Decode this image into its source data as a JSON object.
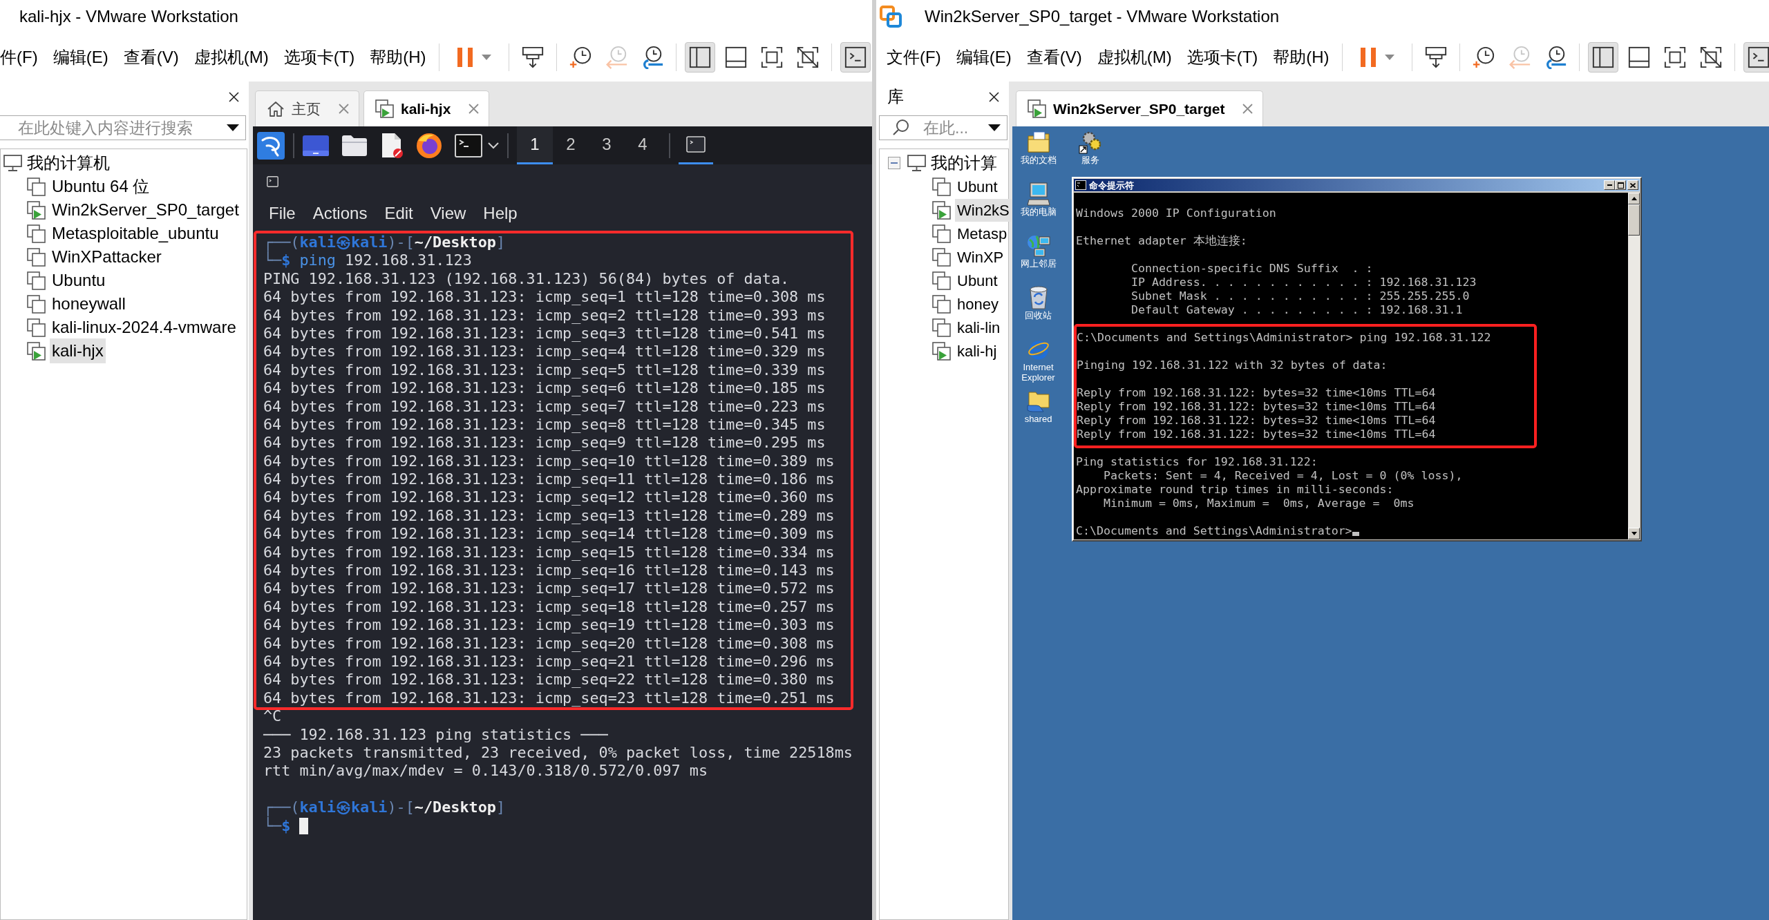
{
  "windows": [
    {
      "title": "kali-hjx - VMware Workstation",
      "menu": [
        "件(F)",
        "编辑(E)",
        "查看(V)",
        "虚拟机(M)",
        "选项卡(T)",
        "帮助(H)"
      ],
      "toolbar": [
        [
          {
            "kind": "pause",
            "dropdown": true
          }
        ],
        [
          {
            "kind": "send_keys"
          }
        ],
        [
          {
            "kind": "snapshot",
            "disabled": false
          },
          {
            "kind": "revert_snapshot",
            "disabled": true
          },
          {
            "kind": "snapshot_manager",
            "disabled": false
          }
        ],
        [
          {
            "kind": "library_view",
            "pressed": true
          },
          {
            "kind": "thumbnail_bar",
            "pressed": false
          },
          {
            "kind": "full_screen",
            "pressed": false
          },
          {
            "kind": "unity",
            "pressed": false
          }
        ],
        [
          {
            "kind": "console_view",
            "pressed": true
          }
        ]
      ],
      "sidebar": {
        "search": {
          "placeholder": "在此处键入内容进行搜索"
        },
        "tree": {
          "label": "我的计算机",
          "children": [
            {
              "label": "Ubuntu 64 位",
              "running": false,
              "selected": false
            },
            {
              "label": "Win2kServer_SP0_target",
              "running": true,
              "selected": false
            },
            {
              "label": "Metasploitable_ubuntu",
              "running": false,
              "selected": false
            },
            {
              "label": "WinXPattacker",
              "running": false,
              "selected": false
            },
            {
              "label": "Ubuntu",
              "running": false,
              "selected": false
            },
            {
              "label": "honeywall",
              "running": false,
              "selected": false
            },
            {
              "label": "kali-linux-2024.4-vmware",
              "running": false,
              "selected": false
            },
            {
              "label": "kali-hjx",
              "running": true,
              "selected": true
            }
          ]
        }
      },
      "tabs": [
        {
          "kind": "home",
          "label": "主页",
          "selected": false
        },
        {
          "kind": "vm",
          "label": "kali-hjx",
          "selected": true
        }
      ],
      "guest": {
        "kind": "kali",
        "panel": {
          "launchers": [
            {
              "kind": "app_menu"
            },
            {
              "kind": "desktop"
            },
            {
              "kind": "files"
            },
            {
              "kind": "text_editor"
            },
            {
              "kind": "web_browser"
            },
            {
              "kind": "terminal",
              "dropdown": true
            }
          ],
          "workspaces": [
            {
              "label": "1",
              "selected": true
            },
            {
              "label": "2",
              "selected": false
            },
            {
              "label": "3",
              "selected": false
            },
            {
              "label": "4",
              "selected": false
            }
          ],
          "tasks": [
            {
              "kind": "terminal",
              "focused": true
            }
          ]
        },
        "terminal": {
          "menu": [
            "File",
            "Actions",
            "Edit",
            "View",
            "Help"
          ],
          "sections": [
            {
              "highlighted": true,
              "paragraphs": [
                [
                  {
                    "parts": [
                      {
                        "kind": "frame",
                        "text": "┌──("
                      },
                      {
                        "kind": "user",
                        "text": "kali㉿kali"
                      },
                      {
                        "kind": "frame",
                        "text": ")-["
                      },
                      {
                        "kind": "path",
                        "text": "~/Desktop"
                      },
                      {
                        "kind": "frame",
                        "text": "]"
                      }
                    ]
                  },
                  {
                    "parts": [
                      {
                        "kind": "frame",
                        "text": "└─"
                      },
                      {
                        "kind": "prompt",
                        "text": "$"
                      },
                      {
                        "kind": "command",
                        "text": "ping"
                      },
                      {
                        "kind": "argument",
                        "text": "192.168.31.123"
                      }
                    ]
                  },
                  "PING 192.168.31.123 (192.168.31.123) 56(84) bytes of data.",
                  "64 bytes from 192.168.31.123: icmp_seq=1 ttl=128 time=0.308 ms",
                  "64 bytes from 192.168.31.123: icmp_seq=2 ttl=128 time=0.393 ms",
                  "64 bytes from 192.168.31.123: icmp_seq=3 ttl=128 time=0.541 ms",
                  "64 bytes from 192.168.31.123: icmp_seq=4 ttl=128 time=0.329 ms",
                  "64 bytes from 192.168.31.123: icmp_seq=5 ttl=128 time=0.339 ms",
                  "64 bytes from 192.168.31.123: icmp_seq=6 ttl=128 time=0.185 ms",
                  "64 bytes from 192.168.31.123: icmp_seq=7 ttl=128 time=0.223 ms",
                  "64 bytes from 192.168.31.123: icmp_seq=8 ttl=128 time=0.345 ms",
                  "64 bytes from 192.168.31.123: icmp_seq=9 ttl=128 time=0.295 ms",
                  "64 bytes from 192.168.31.123: icmp_seq=10 ttl=128 time=0.389 ms",
                  "64 bytes from 192.168.31.123: icmp_seq=11 ttl=128 time=0.186 ms",
                  "64 bytes from 192.168.31.123: icmp_seq=12 ttl=128 time=0.360 ms",
                  "64 bytes from 192.168.31.123: icmp_seq=13 ttl=128 time=0.289 ms",
                  "64 bytes from 192.168.31.123: icmp_seq=14 ttl=128 time=0.309 ms",
                  "64 bytes from 192.168.31.123: icmp_seq=15 ttl=128 time=0.334 ms",
                  "64 bytes from 192.168.31.123: icmp_seq=16 ttl=128 time=0.143 ms",
                  "64 bytes from 192.168.31.123: icmp_seq=17 ttl=128 time=0.572 ms",
                  "64 bytes from 192.168.31.123: icmp_seq=18 ttl=128 time=0.257 ms",
                  "64 bytes from 192.168.31.123: icmp_seq=19 ttl=128 time=0.303 ms",
                  "64 bytes from 192.168.31.123: icmp_seq=20 ttl=128 time=0.308 ms",
                  "64 bytes from 192.168.31.123: icmp_seq=21 ttl=128 time=0.296 ms",
                  "64 bytes from 192.168.31.123: icmp_seq=22 ttl=128 time=0.380 ms",
                  "64 bytes from 192.168.31.123: icmp_seq=23 ttl=128 time=0.251 ms"
                ]
              ]
            },
            {
              "highlighted": false,
              "paragraphs": [
                [
                  "^C",
                  "─── 192.168.31.123 ping statistics ───",
                  "23 packets transmitted, 23 received, 0% packet loss, time 22518ms",
                  "rtt min/avg/max/mdev = 0.143/0.318/0.572/0.097 ms"
                ],
                [
                  {
                    "parts": [
                      {
                        "kind": "frame",
                        "text": "┌──("
                      },
                      {
                        "kind": "user",
                        "text": "kali㉿kali"
                      },
                      {
                        "kind": "frame",
                        "text": ")-["
                      },
                      {
                        "kind": "path",
                        "text": "~/Desktop"
                      },
                      {
                        "kind": "frame",
                        "text": "]"
                      }
                    ]
                  },
                  {
                    "parts": [
                      {
                        "kind": "frame",
                        "text": "└─"
                      },
                      {
                        "kind": "prompt",
                        "text": "$"
                      }
                    ],
                    "cursor": true
                  }
                ]
              ]
            }
          ]
        }
      }
    },
    {
      "app_icon": true,
      "title": "Win2kServer_SP0_target - VMware Workstation",
      "menu": [
        "文件(F)",
        "编辑(E)",
        "查看(V)",
        "虚拟机(M)",
        "选项卡(T)",
        "帮助(H)"
      ],
      "toolbar": [
        [
          {
            "kind": "pause",
            "dropdown": true
          }
        ],
        [
          {
            "kind": "send_keys"
          }
        ],
        [
          {
            "kind": "snapshot",
            "disabled": false
          },
          {
            "kind": "revert_snapshot",
            "disabled": true
          },
          {
            "kind": "snapshot_manager",
            "disabled": false
          }
        ],
        [
          {
            "kind": "library_view",
            "pressed": true
          },
          {
            "kind": "thumbnail_bar",
            "pressed": false
          },
          {
            "kind": "full_screen",
            "pressed": false
          },
          {
            "kind": "unity",
            "pressed": false
          }
        ],
        [
          {
            "kind": "console_view",
            "pressed": true
          }
        ]
      ],
      "sidebar": {
        "title": "库",
        "search": {
          "placeholder": "在此..."
        },
        "tree": {
          "label": "我的计算",
          "expanded": true,
          "children": [
            {
              "label": "Ubunt",
              "running": false,
              "selected": false
            },
            {
              "label": "Win2kS",
              "running": true,
              "selected": true
            },
            {
              "label": "Metasp",
              "running": false,
              "selected": false
            },
            {
              "label": "WinXP",
              "running": false,
              "selected": false
            },
            {
              "label": "Ubunt",
              "running": false,
              "selected": false
            },
            {
              "label": "honey",
              "running": false,
              "selected": false
            },
            {
              "label": "kali-lin",
              "running": false,
              "selected": false
            },
            {
              "label": "kali-hj",
              "running": true,
              "selected": false
            }
          ]
        }
      },
      "tabs": [
        {
          "kind": "vm",
          "label": "Win2kServer_SP0_target",
          "selected": true
        }
      ],
      "guest": {
        "kind": "win2000",
        "desktop_icon_columns": [
          [
            {
              "kind": "documents",
              "label": "我的文档"
            },
            {
              "kind": "computer",
              "label": "我的电脑"
            },
            {
              "kind": "network",
              "label": "网上邻居"
            },
            {
              "kind": "recycle_bin",
              "label": "回收站"
            },
            {
              "kind": "browser",
              "label": "Internet Explorer"
            },
            {
              "kind": "shared_folder",
              "label": "shared"
            }
          ],
          [
            {
              "kind": "services",
              "label": "服务"
            }
          ]
        ],
        "console": {
          "title": "命令提示符",
          "cursor": true,
          "sections": [
            {
              "highlighted": false,
              "paragraphs": [
                [
                  "Windows 2000 IP Configuration"
                ],
                [
                  "Ethernet adapter 本地连接:"
                ],
                [
                  "        Connection-specific DNS Suffix  . :",
                  "        IP Address. . . . . . . . . . . . : 192.168.31.123",
                  "        Subnet Mask . . . . . . . . . . . : 255.255.255.0",
                  "        Default Gateway . . . . . . . . . : 192.168.31.1"
                ]
              ]
            },
            {
              "highlighted": true,
              "paragraphs": [
                [
                  "C:\\Documents and Settings\\Administrator> ping 192.168.31.122"
                ],
                [
                  "Pinging 192.168.31.122 with 32 bytes of data:"
                ],
                [
                  "Reply from 192.168.31.122: bytes=32 time<10ms TTL=64",
                  "Reply from 192.168.31.122: bytes=32 time<10ms TTL=64",
                  "Reply from 192.168.31.122: bytes=32 time<10ms TTL=64",
                  "Reply from 192.168.31.122: bytes=32 time<10ms TTL=64"
                ]
              ]
            },
            {
              "highlighted": false,
              "paragraphs": [
                [
                  "Ping statistics for 192.168.31.122:",
                  "    Packets: Sent = 4, Received = 4, Lost = 0 (0% loss),",
                  "Approximate round trip times in milli-seconds:",
                  "    Minimum = 0ms, Maximum =  0ms, Average =  0ms"
                ],
                [
                  "C:\\Documents and Settings\\Administrator>"
                ]
              ]
            }
          ]
        }
      }
    }
  ]
}
